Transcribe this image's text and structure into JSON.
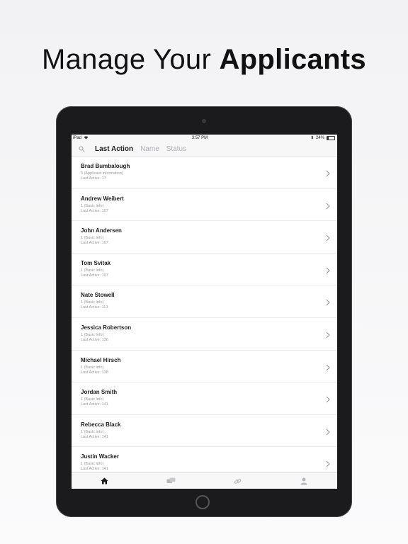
{
  "headline": {
    "light": "Manage Your",
    "bold": "Applicants"
  },
  "status_bar": {
    "carrier": "iPad",
    "time": "3:57 PM",
    "battery": "24%",
    "battery_level": 0.24
  },
  "sort_tabs": [
    "Last Action",
    "Name",
    "Status"
  ],
  "applicants": [
    {
      "name": "Brad Bumbalough",
      "step": "5 (Applicant information)",
      "last_active": "Last Active: 17"
    },
    {
      "name": "Andrew Weibert",
      "step": "1 (Basic Info)",
      "last_active": "Last Active: 107"
    },
    {
      "name": "John Andersen",
      "step": "1 (Basic Info)",
      "last_active": "Last Active: 107"
    },
    {
      "name": "Tom Svitak",
      "step": "1 (Basic Info)",
      "last_active": "Last Active: 107"
    },
    {
      "name": "Nate Stowell",
      "step": "1 (Basic Info)",
      "last_active": "Last Active: 113"
    },
    {
      "name": "Jessica Robertson",
      "step": "1 (Basic Info)",
      "last_active": "Last Active: 136"
    },
    {
      "name": "Michael Hirsch",
      "step": "1 (Basic Info)",
      "last_active": "Last Active: 138"
    },
    {
      "name": "Jordan Smith",
      "step": "1 (Basic Info)",
      "last_active": "Last Active: 141"
    },
    {
      "name": "Rebecca Black",
      "step": "1 (Basic Info)",
      "last_active": "Last Active: 141"
    },
    {
      "name": "Justin Wacker",
      "step": "1 (Basic Info)",
      "last_active": "Last Active: 141"
    }
  ],
  "tab_bar": [
    "home-icon",
    "messages-icon",
    "link-icon",
    "profile-icon"
  ],
  "colors": {
    "active_icon": "#1e1e1e",
    "inactive_icon": "#b5b5ba",
    "device": "#1b1b1d"
  }
}
